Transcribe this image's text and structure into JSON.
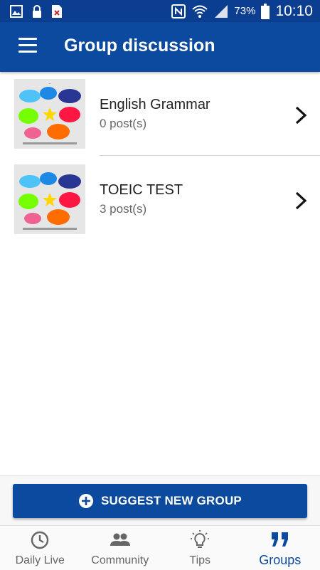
{
  "status_bar": {
    "battery_percent": "73%",
    "time": "10:10",
    "left_icons": [
      "image-icon",
      "lock-icon",
      "file-error-icon"
    ],
    "right_icons": [
      "nfc-icon",
      "wifi-icon",
      "signal-icon",
      "battery-icon"
    ]
  },
  "app_bar": {
    "title": "Group discussion",
    "color": "#0b4a9e"
  },
  "groups": [
    {
      "name": "English Grammar",
      "posts": "0 post(s)"
    },
    {
      "name": "TOEIC TEST",
      "posts": "3 post(s)"
    }
  ],
  "suggest_button": {
    "label": "SUGGEST NEW GROUP"
  },
  "bottom_nav": {
    "active": "Groups",
    "items": [
      {
        "label": "Daily Live",
        "icon": "clock-icon"
      },
      {
        "label": "Community",
        "icon": "people-icon"
      },
      {
        "label": "Tips",
        "icon": "lightbulb-icon"
      },
      {
        "label": "Groups",
        "icon": "quote-icon"
      }
    ]
  }
}
